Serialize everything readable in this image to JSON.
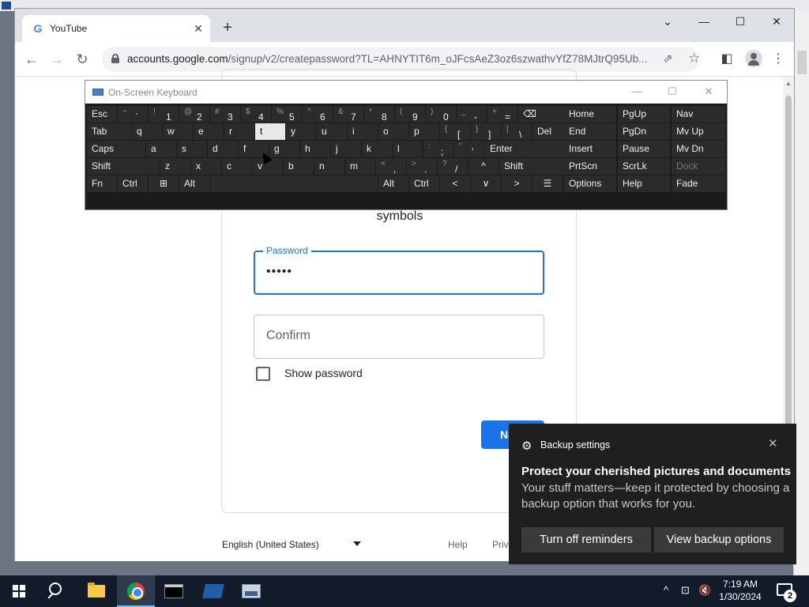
{
  "chrome": {
    "tab": {
      "title": "YouTube",
      "close": "✕",
      "favicon": "G"
    },
    "new_tab": "+",
    "window": {
      "tabsearch": "⌄",
      "minimize": "—",
      "maximize": "☐",
      "close": "✕"
    },
    "nav": {
      "back": "←",
      "forward": "→",
      "reload": "↻"
    },
    "url_host": "accounts.google.com",
    "url_path": "/signup/v2/createpassword?TL=AHNYTIT6m_oJFcsAeZ3oz6szwathvYfZ78MJtrQ95Ub...",
    "icons": {
      "share": "⇗",
      "star": "☆",
      "sidepanel": "◧",
      "menu": "⋮"
    }
  },
  "page": {
    "subtitle": "Create a strong password with a mix of letters, numbers and symbols",
    "password_label": "Password",
    "password_value": "•••••",
    "confirm_placeholder": "Confirm",
    "show_password_label": "Show password",
    "next_label": "Next",
    "footer": {
      "language": "English (United States)",
      "help": "Help",
      "privacy": "Privacy"
    }
  },
  "osk": {
    "title": "On-Screen Keyboard",
    "controls": {
      "minimize": "—",
      "maximize": "☐",
      "close": "✕"
    },
    "rows": {
      "r1": [
        {
          "l": "Esc"
        },
        {
          "s": "~",
          "p": "`"
        },
        {
          "s": "!",
          "p": "1"
        },
        {
          "s": "@",
          "p": "2"
        },
        {
          "s": "#",
          "p": "3"
        },
        {
          "s": "$",
          "p": "4"
        },
        {
          "s": "%",
          "p": "5"
        },
        {
          "s": "^",
          "p": "6"
        },
        {
          "s": "&",
          "p": "7"
        },
        {
          "s": "*",
          "p": "8"
        },
        {
          "s": "(",
          "p": "9"
        },
        {
          "s": ")",
          "p": "0"
        },
        {
          "s": "_",
          "p": "-"
        },
        {
          "s": "+",
          "p": "="
        },
        {
          "l": "⌫"
        }
      ],
      "r2": [
        {
          "l": "Tab"
        },
        {
          "l": "q"
        },
        {
          "l": "w"
        },
        {
          "l": "e"
        },
        {
          "l": "r"
        },
        {
          "l": "t"
        },
        {
          "l": "y"
        },
        {
          "l": "u"
        },
        {
          "l": "i"
        },
        {
          "l": "o"
        },
        {
          "l": "p"
        },
        {
          "s": "{",
          "p": "["
        },
        {
          "s": "}",
          "p": "]"
        },
        {
          "s": "|",
          "p": "\\"
        },
        {
          "l": "Del"
        }
      ],
      "r3": [
        {
          "l": "Caps"
        },
        {
          "l": "a"
        },
        {
          "l": "s"
        },
        {
          "l": "d"
        },
        {
          "l": "f"
        },
        {
          "l": "g"
        },
        {
          "l": "h"
        },
        {
          "l": "j"
        },
        {
          "l": "k"
        },
        {
          "l": "l"
        },
        {
          "s": ":",
          "p": ";"
        },
        {
          "s": "\"",
          "p": "'"
        },
        {
          "l": "Enter"
        }
      ],
      "r4": [
        {
          "l": "Shift"
        },
        {
          "l": "z"
        },
        {
          "l": "x"
        },
        {
          "l": "c"
        },
        {
          "l": "v"
        },
        {
          "l": "b"
        },
        {
          "l": "n"
        },
        {
          "l": "m"
        },
        {
          "s": "<",
          "p": ","
        },
        {
          "s": ">",
          "p": "."
        },
        {
          "s": "?",
          "p": "/"
        },
        {
          "l": "^"
        },
        {
          "l": "Shift"
        }
      ],
      "r5": [
        {
          "l": "Fn"
        },
        {
          "l": "Ctrl"
        },
        {
          "l": "⊞"
        },
        {
          "l": "Alt"
        },
        {
          "l": ""
        },
        {
          "l": "Alt"
        },
        {
          "l": "Ctrl"
        },
        {
          "l": "<"
        },
        {
          "l": "∨"
        },
        {
          "l": ">"
        },
        {
          "l": "☰"
        }
      ]
    },
    "nav_keys": [
      [
        "Home",
        "PgUp",
        "Nav"
      ],
      [
        "End",
        "PgDn",
        "Mv Up"
      ],
      [
        "Insert",
        "Pause",
        "Mv Dn"
      ],
      [
        "PrtScn",
        "ScrLk",
        "Dock"
      ],
      [
        "Options",
        "Help",
        "Fade"
      ]
    ]
  },
  "toast": {
    "app": "Backup settings",
    "close": "✕",
    "headline": "Protect your cherished pictures and documents",
    "body": "Your stuff matters—keep it protected by choosing a backup option that works for you.",
    "btn_off": "Turn off reminders",
    "btn_view": "View backup options"
  },
  "taskbar": {
    "time": "7:19 AM",
    "date": "1/30/2024",
    "notifications": "2",
    "tray": {
      "chevron": "^",
      "network": "⊡",
      "volume": "🔇"
    }
  }
}
